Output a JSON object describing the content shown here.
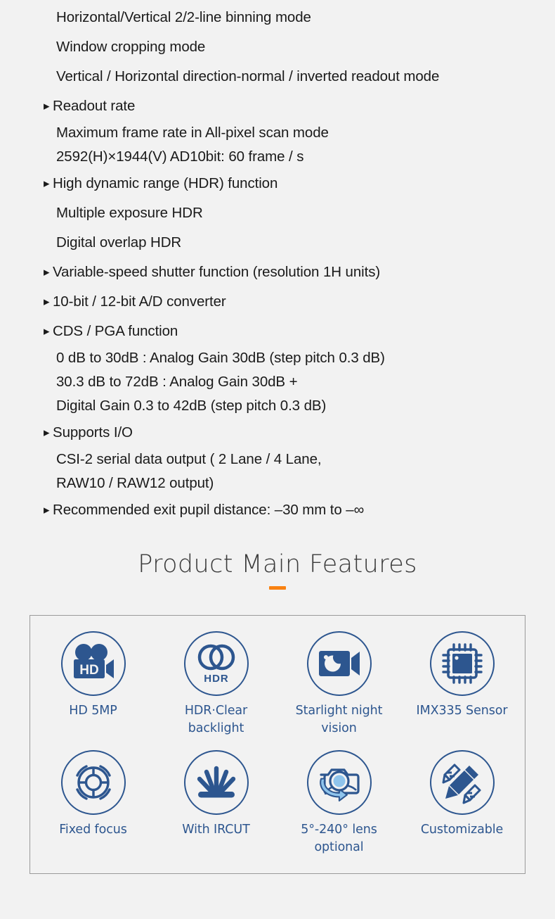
{
  "specs": {
    "lines": [
      {
        "text": "Horizontal/Vertical 2/2-line binning mode",
        "style": "sub"
      },
      {
        "text": "Window cropping mode",
        "style": "sub"
      },
      {
        "text": "Vertical / Horizontal direction-normal / inverted readout mode",
        "style": "sub"
      },
      {
        "text": "Readout rate",
        "style": "bulleted"
      },
      {
        "text": "Maximum frame rate in All-pixel scan mode",
        "style": "sub tight"
      },
      {
        "text": "2592(H)×1944(V)   AD10bit: 60 frame / s",
        "style": "sub tight"
      },
      {
        "text": "High dynamic range (HDR) function",
        "style": "bulleted"
      },
      {
        "text": "Multiple exposure HDR",
        "style": "sub"
      },
      {
        "text": "Digital overlap HDR",
        "style": "sub"
      },
      {
        "text": "Variable-speed shutter function (resolution 1H units)",
        "style": "bulleted"
      },
      {
        "text": "10-bit / 12-bit A/D converter",
        "style": "bulleted"
      },
      {
        "text": "CDS / PGA function",
        "style": "bulleted"
      },
      {
        "text": "0 dB to 30dB : Analog Gain 30dB (step pitch 0.3 dB)",
        "style": "sub tight"
      },
      {
        "text": "30.3 dB to 72dB : Analog Gain 30dB +",
        "style": "sub tight"
      },
      {
        "text": "Digital Gain 0.3 to 42dB (step pitch 0.3 dB)",
        "style": "sub tight"
      },
      {
        "text": "Supports I/O",
        "style": "bulleted"
      },
      {
        "text": "CSI-2 serial data output ( 2 Lane / 4 Lane,",
        "style": "sub tight"
      },
      {
        "text": "RAW10 / RAW12 output)",
        "style": "sub tight"
      },
      {
        "text": "Recommended exit pupil distance: –30 mm to –∞",
        "style": "bulleted"
      }
    ]
  },
  "section": {
    "title": "Product Main Features",
    "accent_color": "#f98211"
  },
  "features": {
    "icon_color": "#2d568f",
    "accent_light": "#8fc4ec",
    "items": [
      {
        "label": "HD 5MP",
        "icon": "hd-camcorder-icon"
      },
      {
        "label": "HDR·Clear backlight",
        "icon": "hdr-overlapping-circles-icon"
      },
      {
        "label": "Starlight night vision",
        "icon": "night-vision-camera-icon"
      },
      {
        "label": "IMX335 Sensor",
        "icon": "microchip-icon"
      },
      {
        "label": "Fixed focus",
        "icon": "focus-lens-ring-icon"
      },
      {
        "label": "With IRCUT",
        "icon": "sunburst-rays-icon"
      },
      {
        "label": "5°-240° lens optional",
        "icon": "camera-rotate-lens-icon"
      },
      {
        "label": "Customizable",
        "icon": "pencil-edit-icon"
      }
    ]
  }
}
